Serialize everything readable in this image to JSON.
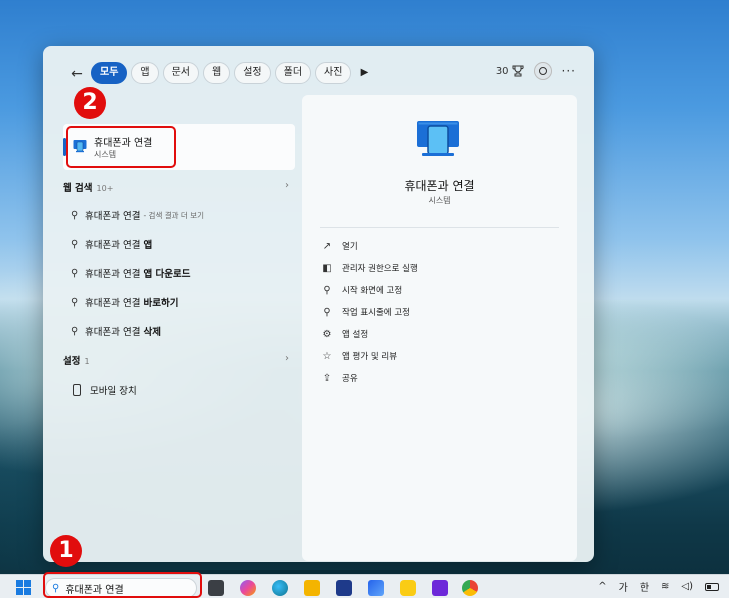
{
  "start_menu": {
    "back_icon": "arrow-left-icon",
    "chips": [
      "모두",
      "앱",
      "문서",
      "웹",
      "설정",
      "폴더",
      "사진"
    ],
    "points": "30",
    "more": "···"
  },
  "left": {
    "best_match": {
      "name": "휴대폰과 연결",
      "sub": "시스템"
    },
    "web_search": {
      "title": "웹 검색",
      "count": "10+",
      "results": [
        {
          "text": "휴대폰과 연결",
          "bold": "",
          "suffix": "- 검색 결과 더 보기"
        },
        {
          "text": "휴대폰과 연결",
          "bold": "앱",
          "suffix": ""
        },
        {
          "text": "휴대폰과 연결",
          "bold": "앱 다운로드",
          "suffix": ""
        },
        {
          "text": "휴대폰과 연결",
          "bold": "바로하기",
          "suffix": ""
        },
        {
          "text": "휴대폰과 연결",
          "bold": "삭제",
          "suffix": ""
        }
      ]
    },
    "settings": {
      "title": "설정",
      "count": "1",
      "item": "모바일 장치"
    }
  },
  "right": {
    "title": "휴대폰과 연결",
    "sub": "시스템",
    "actions": [
      {
        "icon": "open-icon",
        "label": "열기"
      },
      {
        "icon": "admin-icon",
        "label": "관리자 권한으로 실행"
      },
      {
        "icon": "pin-icon",
        "label": "시작 화면에 고정"
      },
      {
        "icon": "pin-icon",
        "label": "작업 표시줄에 고정"
      },
      {
        "icon": "gear-icon",
        "label": "앱 설정"
      },
      {
        "icon": "rate-icon",
        "label": "앱 평가 및 리뷰"
      },
      {
        "icon": "share-icon",
        "label": "공유"
      }
    ]
  },
  "annotations": {
    "badge1": "1",
    "badge2": "2",
    "color": "#e10d0d"
  },
  "taskbar": {
    "search_value": "휴대폰과 연결",
    "tray": {
      "ime_mode": "가",
      "lang": "한"
    }
  },
  "colors": {
    "accent": "#1762c4"
  }
}
